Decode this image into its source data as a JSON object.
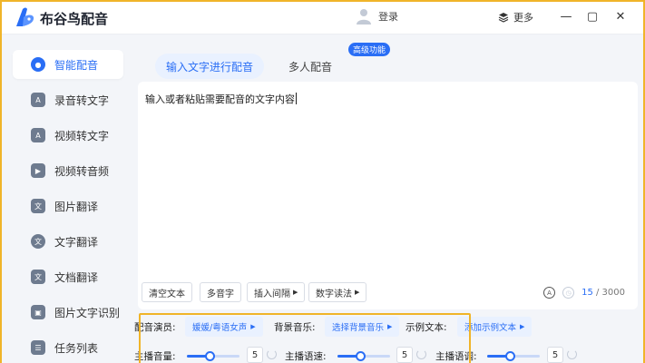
{
  "app": {
    "title": "布谷鸟配音"
  },
  "header": {
    "login_label": "登录",
    "more_label": "更多",
    "minimize": "—",
    "maximize": "▢",
    "close": "✕"
  },
  "sidebar": {
    "items": [
      {
        "label": "智能配音",
        "icon": "smart-dub-icon",
        "active": true
      },
      {
        "label": "录音转文字",
        "icon": "audio-to-text-icon",
        "active": false
      },
      {
        "label": "视频转文字",
        "icon": "video-to-text-icon",
        "active": false
      },
      {
        "label": "视频转音频",
        "icon": "video-to-audio-icon",
        "active": false
      },
      {
        "label": "图片翻译",
        "icon": "image-translate-icon",
        "active": false
      },
      {
        "label": "文字翻译",
        "icon": "text-translate-icon",
        "active": false
      },
      {
        "label": "文档翻译",
        "icon": "doc-translate-icon",
        "active": false
      },
      {
        "label": "图片文字识别",
        "icon": "ocr-icon",
        "active": false
      },
      {
        "label": "任务列表",
        "icon": "task-list-icon",
        "active": false
      }
    ]
  },
  "tabs": [
    {
      "label": "输入文字进行配音",
      "active": true
    },
    {
      "label": "多人配音",
      "active": false,
      "badge": "高级功能"
    }
  ],
  "editor": {
    "placeholder": "输入或者粘贴需要配音的文字内容",
    "toolbar": {
      "clear": "清空文本",
      "polyphone": "多音字",
      "insert_pause": "插入间隔",
      "number_reading": "数字读法"
    },
    "count_current": "15",
    "count_max": "/ 3000"
  },
  "settings": {
    "voice_label": "配音演员:",
    "voice_value": "媛媛/粤语女声",
    "bgm_label": "背景音乐:",
    "bgm_value": "选择背景音乐",
    "sample_label": "示例文本:",
    "sample_value": "添加示例文本",
    "volume_label": "主播音量:",
    "volume_value": "5",
    "volume_level": 0.43,
    "speed_label": "主播语速:",
    "speed_value": "5",
    "speed_level": 0.43,
    "pitch_label": "主播语调:",
    "pitch_value": "5",
    "pitch_level": 0.43
  },
  "colors": {
    "accent": "#2a6ef5",
    "highlight": "#f0b429"
  }
}
